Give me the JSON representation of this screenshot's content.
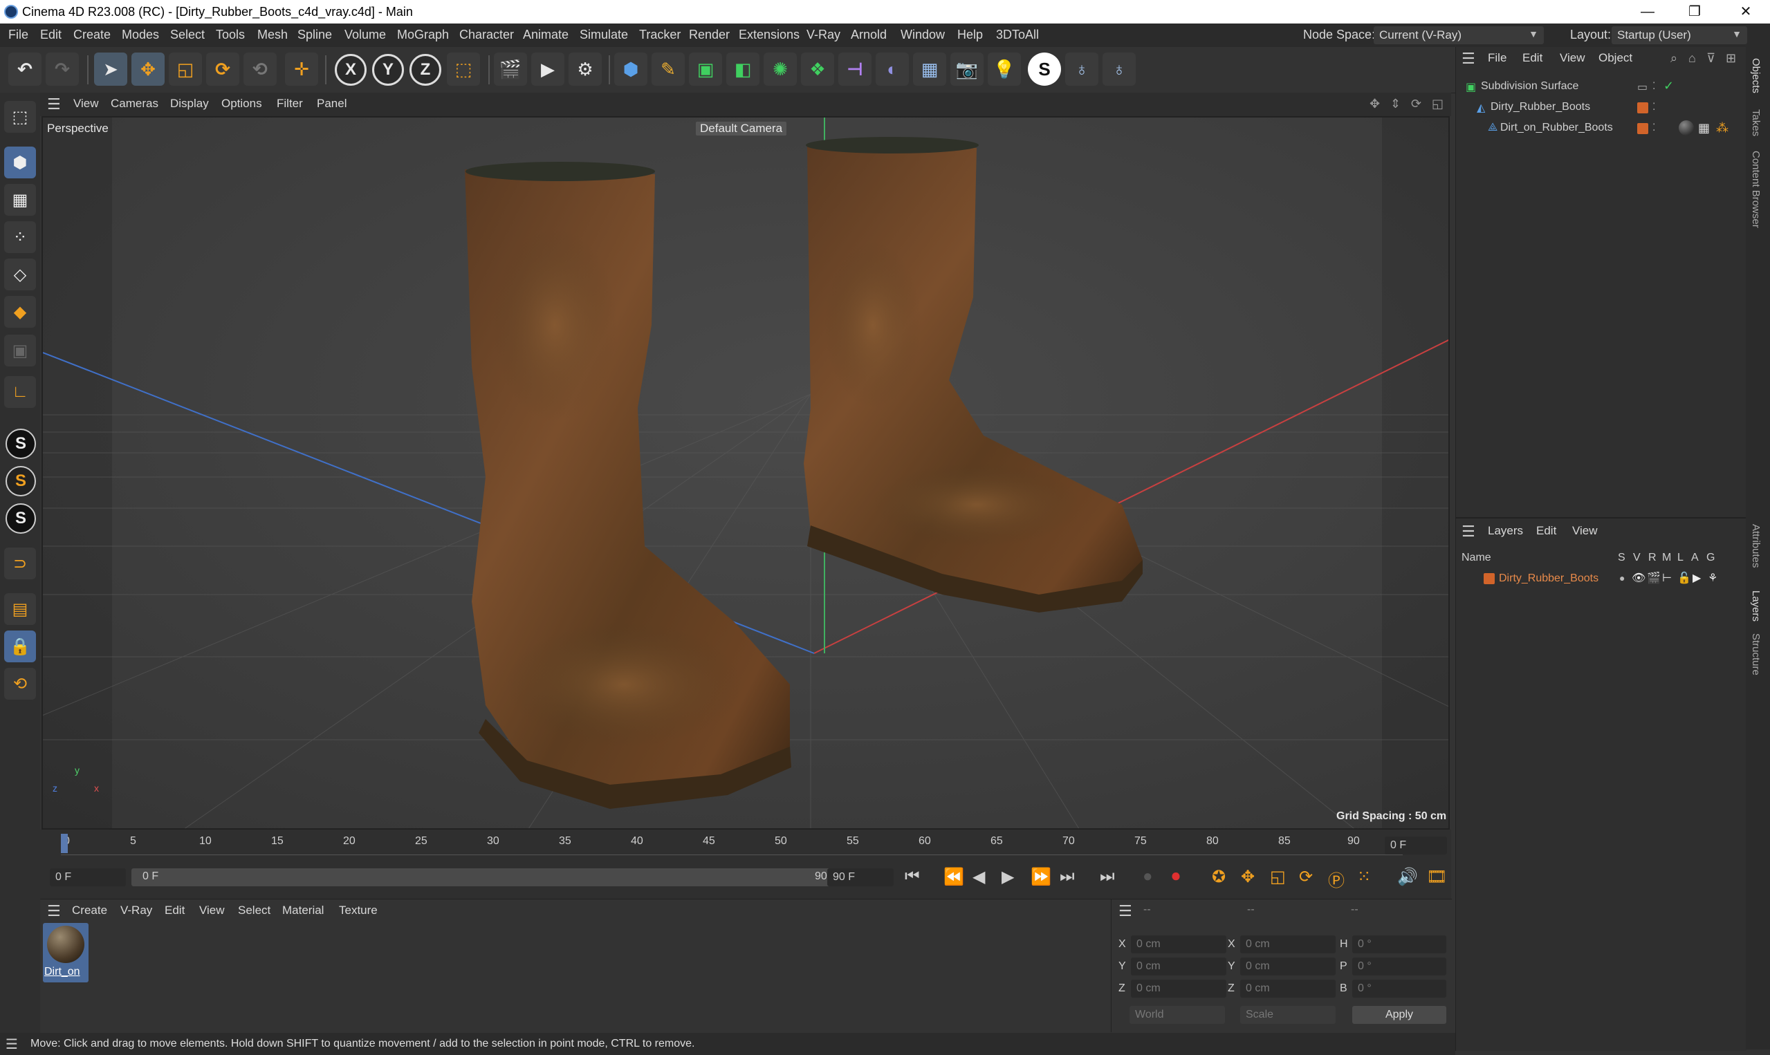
{
  "window": {
    "title": "Cinema 4D R23.008 (RC) - [Dirty_Rubber_Boots_c4d_vray.c4d] - Main",
    "minimize": "—",
    "maximize": "❐",
    "close": "✕"
  },
  "menubar": {
    "items": [
      "File",
      "Edit",
      "Create",
      "Modes",
      "Select",
      "Tools",
      "Mesh",
      "Spline",
      "Volume",
      "MoGraph",
      "Character",
      "Animate",
      "Simulate",
      "Tracker",
      "Render",
      "Extensions",
      "V-Ray",
      "Arnold",
      "Window",
      "Help",
      "3DToAll"
    ],
    "node_space_label": "Node Space:",
    "node_space_value": "Current (V-Ray)",
    "layout_label": "Layout:",
    "layout_value": "Startup (User)"
  },
  "viewport": {
    "menu": [
      "View",
      "Cameras",
      "Display",
      "Options",
      "Filter",
      "Panel"
    ],
    "view_name": "Perspective",
    "camera": "Default Camera",
    "grid_spacing": "Grid Spacing : 50 cm",
    "axis_x": "x",
    "axis_y": "y",
    "axis_z": "z"
  },
  "timeline": {
    "ticks": [
      "0",
      "5",
      "10",
      "15",
      "20",
      "25",
      "30",
      "35",
      "40",
      "45",
      "50",
      "55",
      "60",
      "65",
      "70",
      "75",
      "80",
      "85",
      "90"
    ],
    "current_frame": "0 F",
    "start_frame": "0 F",
    "range_start": "0 F",
    "range_end": "90 F",
    "end_frame": "90 F"
  },
  "material_manager": {
    "menu": [
      "Create",
      "V-Ray",
      "Edit",
      "View",
      "Select",
      "Material",
      "Texture"
    ],
    "materials": [
      {
        "name": "Dirt_on"
      }
    ]
  },
  "coordinates": {
    "header": [
      "--",
      "--",
      "--"
    ],
    "rows": [
      {
        "a": "X",
        "av": "0 cm",
        "b": "X",
        "bv": "0 cm",
        "c": "H",
        "cv": "0 °"
      },
      {
        "a": "Y",
        "av": "0 cm",
        "b": "Y",
        "bv": "0 cm",
        "c": "P",
        "cv": "0 °"
      },
      {
        "a": "Z",
        "av": "0 cm",
        "b": "Z",
        "bv": "0 cm",
        "c": "B",
        "cv": "0 °"
      }
    ],
    "mode": "World",
    "scale": "Scale",
    "apply": "Apply"
  },
  "object_manager": {
    "menu": [
      "File",
      "Edit",
      "View",
      "Object"
    ],
    "objects": [
      {
        "name": "Subdivision Surface"
      },
      {
        "name": "Dirty_Rubber_Boots"
      },
      {
        "name": "Dirt_on_Rubber_Boots"
      }
    ]
  },
  "layer_manager": {
    "menu": [
      "Layers",
      "Edit",
      "View"
    ],
    "columns": [
      "Name",
      "S",
      "V",
      "R",
      "M",
      "L",
      "A",
      "G"
    ],
    "layers": [
      {
        "name": "Dirty_Rubber_Boots"
      }
    ]
  },
  "side_tabs": [
    "Objects",
    "Takes",
    "Content Browser",
    "Attributes",
    "Layers",
    "Structure"
  ],
  "status": "Move: Click and drag to move elements. Hold down SHIFT to quantize movement / add to the selection in point mode, CTRL to remove.",
  "colors": {
    "accent": "#d2642a",
    "selection": "#4a6a9a"
  }
}
